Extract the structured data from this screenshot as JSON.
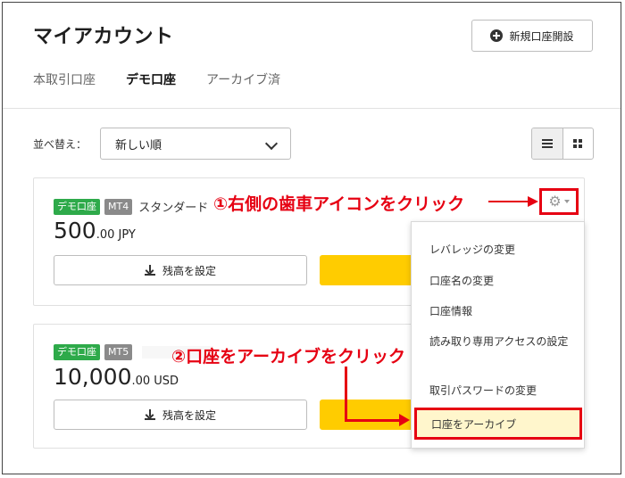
{
  "header": {
    "title": "マイアカウント",
    "new_account_label": "新規口座開設"
  },
  "tabs": [
    {
      "label": "本取引口座",
      "active": false
    },
    {
      "label": "デモ口座",
      "active": true
    },
    {
      "label": "アーカイブ済",
      "active": false
    }
  ],
  "sort": {
    "label": "並べ替え：",
    "selected": "新しい順"
  },
  "view_toggle": {
    "active": "list"
  },
  "accounts": [
    {
      "badge_type": "デモ口座",
      "platform": "MT4",
      "name": "スタンダード",
      "balance_int": "500",
      "balance_dec": ".00 JPY",
      "set_balance_label": "残高を設定"
    },
    {
      "badge_type": "デモ口座",
      "platform": "MT5",
      "balance_int": "10,000",
      "balance_dec": ".00 USD",
      "set_balance_label": "残高を設定"
    }
  ],
  "annotations": {
    "step1": "①右側の歯車アイコンをクリック",
    "step2": "②口座をアーカイブをクリック"
  },
  "menu": {
    "items": [
      "レバレッジの変更",
      "口座名の変更",
      "口座情報",
      "読み取り専用アクセスの設定",
      "取引パスワードの変更"
    ],
    "archive_label": "口座をアーカイブ"
  },
  "colors": {
    "accent_red": "#e60012",
    "demo_green": "#2eaa4a",
    "cta_yellow": "#ffcc00"
  }
}
